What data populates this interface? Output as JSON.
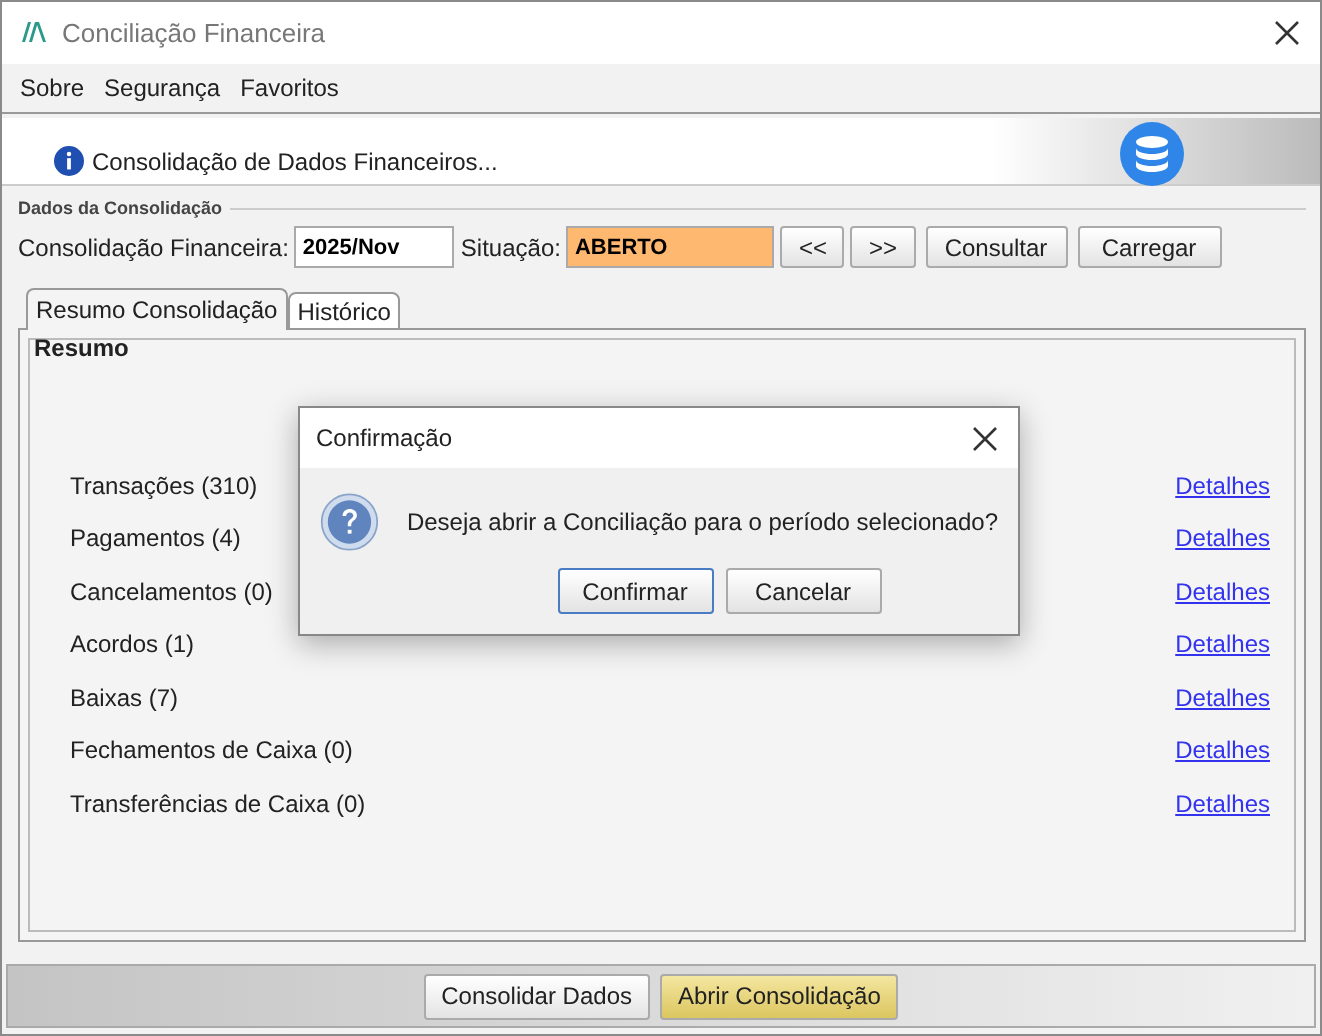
{
  "window": {
    "title": "Conciliação Financeira"
  },
  "menu": [
    {
      "label": "Sobre"
    },
    {
      "label": "Segurança"
    },
    {
      "label": "Favoritos"
    }
  ],
  "banner": {
    "text": "Consolidação de Dados Financeiros..."
  },
  "group": {
    "title": "Dados da Consolidação",
    "period_label": "Consolidação Financeira:",
    "period_value": "2025/Nov",
    "status_label": "Situação:",
    "status_value": "ABERTO",
    "buttons": [
      "<<",
      ">>",
      "Consultar",
      "Carregar"
    ]
  },
  "tabs": [
    {
      "label": "Resumo Consolidação",
      "selected": true
    },
    {
      "label": "Histórico",
      "selected": false
    }
  ],
  "summary": {
    "title": "Resumo",
    "rows": [
      {
        "label": "Transações",
        "count": "(310)",
        "link": "Detalhes"
      },
      {
        "label": "Pagamentos",
        "count": "(4)",
        "link": "Detalhes"
      },
      {
        "label": "Cancelamentos",
        "count": "(0)",
        "link": "Detalhes"
      },
      {
        "label": "Acordos",
        "count": "(1)",
        "link": "Detalhes"
      },
      {
        "label": "Baixas",
        "count": "(7)",
        "link": "Detalhes"
      },
      {
        "label": "Fechamentos de Caixa",
        "count": "(0)",
        "link": "Detalhes"
      },
      {
        "label": "Transferências de Caixa",
        "count": "(0)",
        "link": "Detalhes"
      }
    ]
  },
  "footer_buttons": [
    {
      "label": "Consolidar Dados",
      "highlighted": false
    },
    {
      "label": "Abrir Consolidação",
      "highlighted": true
    }
  ],
  "dialog": {
    "title": "Confirmação",
    "message": "Deseja abrir a Conciliação para o período selecionado?",
    "buttons": [
      {
        "label": "Confirmar",
        "default": true
      },
      {
        "label": "Cancelar",
        "default": false
      }
    ]
  }
}
